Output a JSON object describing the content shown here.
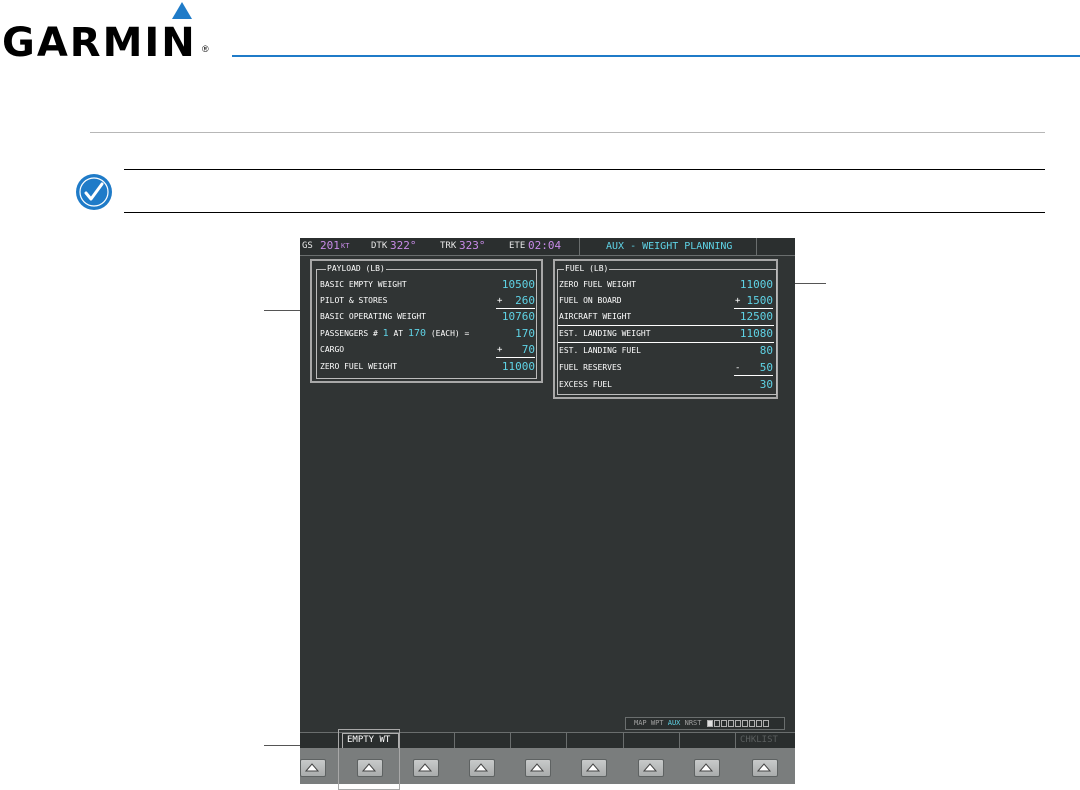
{
  "header": {
    "logo_text": "GARMIN",
    "logo_mark": "®",
    "brand_color": "#1f7bc8"
  },
  "note_icon": "pencil-note-icon",
  "topbar": {
    "gs_label": "GS",
    "gs_value": "201",
    "gs_unit": "KT",
    "dtk_label": "DTK",
    "dtk_value": "322°",
    "trk_label": "TRK",
    "trk_value": "323°",
    "ete_label": "ETE",
    "ete_value": "02:04",
    "page_title": "AUX - WEIGHT PLANNING"
  },
  "payload": {
    "title": "PAYLOAD (LB)",
    "rows": [
      {
        "label": "BASIC EMPTY WEIGHT",
        "value": "10500",
        "sign": ""
      },
      {
        "label": "PILOT & STORES",
        "value": "260",
        "sign": "+"
      },
      {
        "label": "BASIC OPERATING WEIGHT",
        "value": "10760",
        "sign": ""
      },
      {
        "label": "PASSENGERS #",
        "value": "170",
        "sign": ""
      },
      {
        "label": "CARGO",
        "value": "70",
        "sign": "+"
      },
      {
        "label": "ZERO FUEL WEIGHT",
        "value": "11000",
        "sign": ""
      }
    ],
    "pax_count": "1",
    "pax_at": "AT",
    "pax_each_weight": "170",
    "pax_each": "(EACH) ="
  },
  "fuel": {
    "title": "FUEL (LB)",
    "rows": [
      {
        "label": "ZERO FUEL WEIGHT",
        "value": "11000",
        "sign": ""
      },
      {
        "label": "FUEL ON BOARD",
        "value": "1500",
        "sign": "+"
      },
      {
        "label": "AIRCRAFT WEIGHT",
        "value": "12500",
        "sign": ""
      },
      {
        "label": "EST. LANDING WEIGHT",
        "value": "11080",
        "sign": ""
      },
      {
        "label": "EST. LANDING FUEL",
        "value": "80",
        "sign": ""
      },
      {
        "label": "FUEL RESERVES",
        "value": "50",
        "sign": "-"
      },
      {
        "label": "EXCESS FUEL",
        "value": "30",
        "sign": ""
      }
    ]
  },
  "page_group": {
    "map": "MAP",
    "wpt": "WPT",
    "aux": "AUX",
    "nrst": "NRST"
  },
  "softkeys": {
    "empty_wt": "EMPTY WT",
    "checklist": "CHKLIST"
  },
  "colors": {
    "cyan": "#5fd3e6",
    "magenta": "#c88be8",
    "screen_bg": "#303434"
  }
}
